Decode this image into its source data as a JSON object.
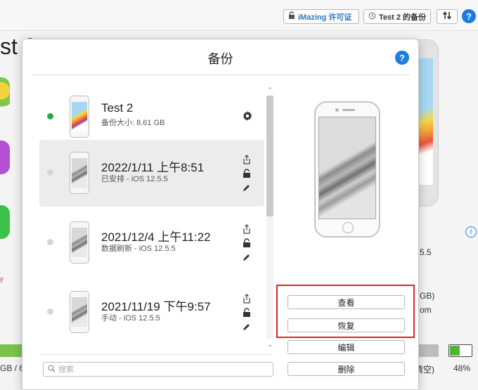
{
  "topbar": {
    "license_label": "iMazing 许可证",
    "backup_label": "Test 2 的备份",
    "help_label": "?"
  },
  "background": {
    "title_fragment": "st 2",
    "info_label": "i",
    "ios_fragment": "5.5",
    "gb_fragment": "GB)",
    "com_fragment": "om",
    "storage_fragment": "GB / 6",
    "empty_fragment": "清空)",
    "battery_level_percent": 48,
    "battery_label": "48%",
    "red_fragment": "y"
  },
  "dialog": {
    "title": "备份",
    "help_label": "?",
    "backups": [
      {
        "title": "Test 2",
        "subtitle": "备份大小: 8.61 GB",
        "status": "current",
        "screen": "color"
      },
      {
        "title": "2022/1/11 上午8:51",
        "subtitle": "已安排 - iOS 12.5.5",
        "status": "archived",
        "screen": "gray",
        "selected": true
      },
      {
        "title": "2021/12/4 上午11:22",
        "subtitle": "数据刷新 - iOS 12.5.5",
        "status": "archived",
        "screen": "gray"
      },
      {
        "title": "2021/11/19 下午9:57",
        "subtitle": "手动 - iOS 12.5.5",
        "status": "archived",
        "screen": "gray"
      }
    ],
    "search": {
      "placeholder": "搜索",
      "value": ""
    },
    "actions": {
      "view_label": "查看",
      "restore_label": "恢复",
      "edit_label": "编辑",
      "delete_label": "删除"
    }
  },
  "colors": {
    "accent_blue": "#1a7de0",
    "current_dot": "#27a844",
    "highlight_red": "#d9242a",
    "battery_green": "#4fb532"
  }
}
